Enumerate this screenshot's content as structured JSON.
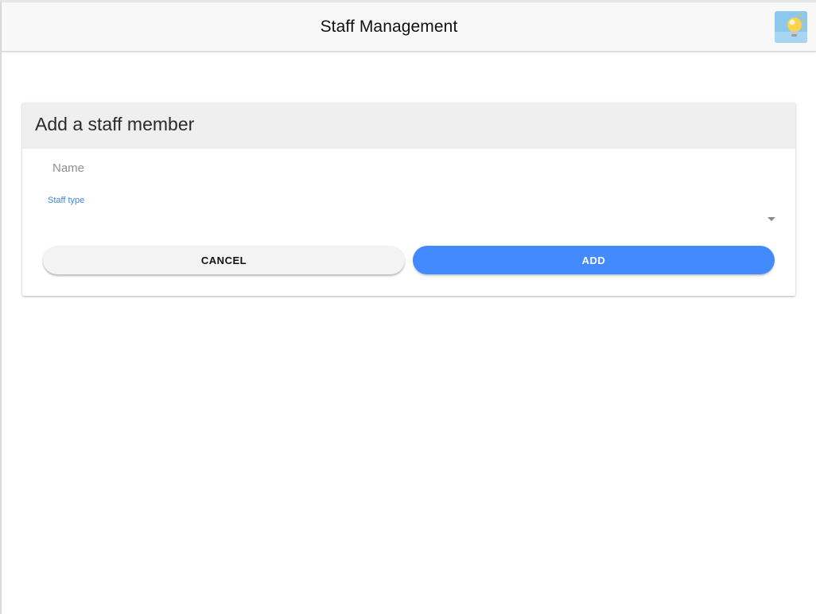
{
  "header": {
    "title": "Staff Management",
    "avatar_icon": "lightbulb-avatar-icon"
  },
  "form": {
    "title": "Add a staff member",
    "name": {
      "placeholder": "Name",
      "value": ""
    },
    "staff_type": {
      "label": "Staff type",
      "selected": ""
    },
    "cancel_label": "CANCEL",
    "add_label": "ADD"
  },
  "colors": {
    "accent": "#448aff",
    "label_blue": "#3b86e0",
    "header_bg": "#f8f8f8",
    "card_header_bg": "#efefef",
    "cancel_bg": "#f3f3f3"
  }
}
